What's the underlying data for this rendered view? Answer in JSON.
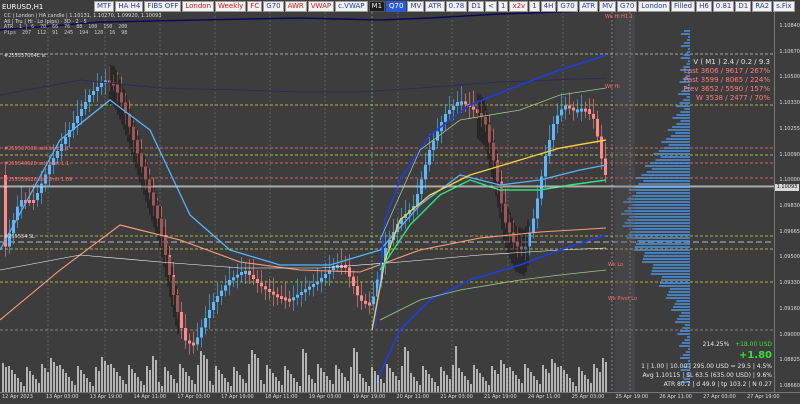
{
  "toolbar": {
    "buttons": [
      {
        "label": "MTF",
        "style": "normal"
      },
      {
        "label": "HA H4",
        "style": "normal"
      },
      {
        "label": "FIBS OFF",
        "style": "normal"
      },
      {
        "label": "London",
        "style": "red"
      },
      {
        "label": "Weekly",
        "style": "red"
      },
      {
        "label": "FC",
        "style": "red"
      },
      {
        "label": "G70",
        "style": "normal"
      },
      {
        "label": "AWR",
        "style": "red"
      },
      {
        "label": "VWAP",
        "style": "red"
      },
      {
        "label": "c.VWAP",
        "style": "normal"
      },
      {
        "label": "M1",
        "style": "dark"
      },
      {
        "label": "Q70",
        "style": "blue"
      },
      {
        "label": "MV",
        "style": "normal"
      },
      {
        "label": "ATR",
        "style": "normal"
      },
      {
        "label": "0.78",
        "style": "normal"
      },
      {
        "label": "D1",
        "style": "normal"
      },
      {
        "label": "<",
        "style": "normal"
      },
      {
        "label": "1",
        "style": "normal"
      },
      {
        "label": "x2v",
        "style": "red"
      },
      {
        "label": "1",
        "style": "normal"
      },
      {
        "label": "4H",
        "style": "normal"
      },
      {
        "label": "G70",
        "style": "normal"
      },
      {
        "label": "ATR",
        "style": "normal"
      },
      {
        "label": "MV",
        "style": "normal"
      },
      {
        "label": "G70",
        "style": "normal"
      },
      {
        "label": "London",
        "style": "normal"
      },
      {
        "label": "Filled",
        "style": "normal"
      },
      {
        "label": "H6",
        "style": "normal"
      },
      {
        "label": "0.81",
        "style": "normal"
      },
      {
        "label": "D1",
        "style": "normal"
      },
      {
        "label": "RA2",
        "style": "normal"
      },
      {
        "label": "s.Fix",
        "style": "normal"
      }
    ]
  },
  "symbol": "EURUSD,H1",
  "info_line1": "CC | London | HA candle | 1.10131, 1.10270, 1.09920, 1.10093",
  "info_line2": "All | Tru | Hi · Lo (pips) · 3D · 2 · 5",
  "stats_table": [
    [
      "ATR",
      "1 | 6",
      "70",
      "66",
      "76",
      "88",
      "100",
      "150",
      "200"
    ],
    [
      "Pips",
      "207",
      "112",
      "91",
      "245",
      "194",
      "120",
      "16",
      "98"
    ]
  ],
  "levels": [
    {
      "text": "#255537004E st",
      "color": "white"
    },
    {
      "text": "#255537036 sell limit 1.1",
      "color": "red"
    },
    {
      "text": "#255540620 sell limit 1.1",
      "color": "red"
    },
    {
      "text": "#255539626 sell limit 1.09",
      "color": "red"
    },
    {
      "text": "#255534 SL",
      "color": "white"
    },
    {
      "text": "Wk Hi H1 1",
      "color": "red"
    },
    {
      "text": "Wk Hi",
      "color": "red"
    },
    {
      "text": "Wk Lo",
      "color": "red"
    },
    {
      "text": "Wk Pivot Lo",
      "color": "red"
    }
  ],
  "price_scale": [
    "1.10840",
    "1.10670",
    "1.10500",
    "1.10330",
    "1.10255",
    "1.10090",
    "1.10000",
    "1.09830",
    "1.09665",
    "1.09500",
    "1.09330",
    "1.09160",
    "1.09000",
    "1.08825",
    "1.08660"
  ],
  "current_price": "1.10093",
  "time_axis": [
    "12 Apr 2023",
    "13 Apr 03:00",
    "13 Apr 19:00",
    "14 Apr 11:00",
    "17 Apr 03:00",
    "17 Apr 19:00",
    "18 Apr 11:00",
    "19 Apr 03:00",
    "19 Apr 19:00",
    "20 Apr 11:00",
    "21 Apr 03:00",
    "21 Apr 19:00",
    "24 Apr 11:00",
    "25 Apr 03:00",
    "25 Apr 19:00",
    "26 Apr 11:00",
    "27 Apr 03:00",
    "27 Apr 19:00"
  ],
  "vmbox": {
    "line1": "V ( M1 )  2.4 / 0.2 / 9.3",
    "line2": "Last  3606 / 9617 / 267%",
    "line3": "Past  3599 / 8065 / 224%",
    "line4": "Prev  3652 / 5590 / 157%",
    "line5": "W  3538 / 2477 / 70%"
  },
  "stats": {
    "pct": "214.25%",
    "usd": "+18.00 USD",
    "big": "+1.80",
    "row1": "1  |  1.00  |  10.00  |  295.00 USD = 29.5  |  4.5%",
    "row2": "Avg 1.10115  |  SL 63.5 (635.00 USD)  |  9.6%",
    "row3": "ATR 80.7  |  d 49.9  |  tp 103.2  |  N 0.27"
  },
  "colors": {
    "bull": "#5bb8ff",
    "bear": "#ff8a8a",
    "bg": "#3d3d3d"
  }
}
